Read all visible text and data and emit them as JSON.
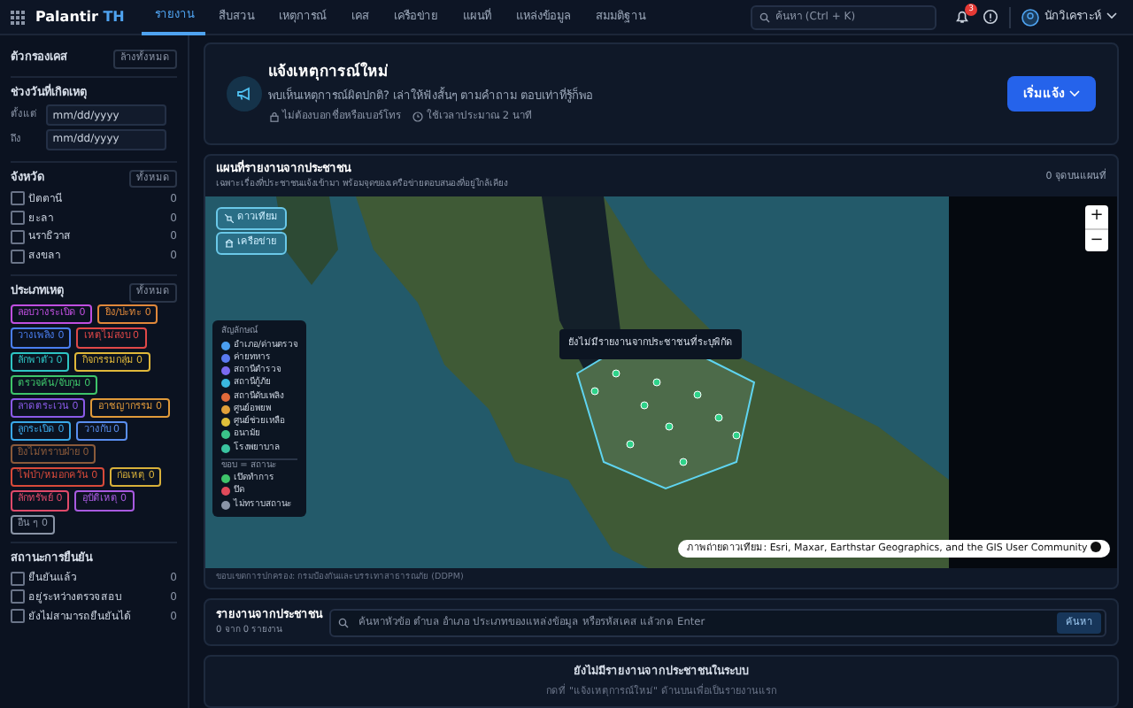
{
  "navbar": {
    "brand": "Palantir",
    "brand_suffix": "TH",
    "items": [
      {
        "label": "รายงาน",
        "selected": true
      },
      {
        "label": "สืบสวน",
        "selected": false
      },
      {
        "label": "เหตุการณ์",
        "selected": false
      },
      {
        "label": "เคส",
        "selected": false
      },
      {
        "label": "เครือข่าย",
        "selected": false
      },
      {
        "label": "แผนที่",
        "selected": false
      },
      {
        "label": "แหล่งข้อมูล",
        "selected": false
      },
      {
        "label": "สมมติฐาน",
        "selected": false
      }
    ],
    "search": {
      "placeholder": "ค้นหา (Ctrl + K)"
    },
    "notification_count": "3",
    "user": "นักวิเคราะห์"
  },
  "sidebar": {
    "title": "ตัวกรองเคส",
    "clear_button": "ล้างทั้งหมด",
    "date_range": {
      "title": "ช่วงวันที่เกิดเหตุ",
      "fields": [
        {
          "label": "ตั้งแต่",
          "placeholder": "mm/dd/yyyy"
        },
        {
          "label": "ถึง",
          "placeholder": "mm/dd/yyyy"
        }
      ]
    },
    "provinces": {
      "title": "จังหวัด",
      "all_button": "ทั้งหมด",
      "items": [
        {
          "label": "ปัตตานี",
          "count": "0",
          "checked": false
        },
        {
          "label": "ยะลา",
          "count": "0",
          "checked": false
        },
        {
          "label": "นราธิวาส",
          "count": "0",
          "checked": false
        },
        {
          "label": "สงขลา",
          "count": "0",
          "checked": false
        }
      ]
    },
    "incident_types": {
      "title": "ประเภทเหตุ",
      "all_button": "ทั้งหมด",
      "items": [
        {
          "label": "ลอบวางระเบิด 0",
          "color": "#c04fe0"
        },
        {
          "label": "ยิง/ปะทะ 0",
          "color": "#e0883a"
        },
        {
          "label": "วางเพลิง 0",
          "color": "#4a7ef0"
        },
        {
          "label": "เหตุไม่สงบ 0",
          "color": "#e04848"
        },
        {
          "label": "ลักพาตัว 0",
          "color": "#2ec4c4"
        },
        {
          "label": "กิจกรรมกลุ่ม 0",
          "color": "#e0b83a"
        },
        {
          "label": "ตรวจค้น/จับกุม 0",
          "color": "#3ec46a"
        },
        {
          "label": "ลาดตระเวน 0",
          "color": "#8a5ae8"
        },
        {
          "label": "อาชญากรรม 0",
          "color": "#e09a3a"
        },
        {
          "label": "ลูกระเบิด 0",
          "color": "#3aa8e8"
        },
        {
          "label": "วางกับ 0",
          "color": "#5a8ef0"
        },
        {
          "label": "ยิงไม่ทราบฝ่าย 0",
          "color": "#8a5a3a"
        },
        {
          "label": "ไฟป่า/หมอกควัน 0",
          "color": "#d84a3a"
        },
        {
          "label": "ก่อเหตุ 0",
          "color": "#d8b03a"
        },
        {
          "label": "ลักทรัพย์ 0",
          "color": "#e04a6a"
        },
        {
          "label": "อุบัติเหตุ 0",
          "color": "#a85ae0"
        },
        {
          "label": "อื่น ๆ 0",
          "color": "#8a94a6"
        }
      ]
    },
    "verification": {
      "title": "สถานะการยืนยัน",
      "items": [
        {
          "label": "ยืนยันแล้ว",
          "count": "0",
          "checked": false
        },
        {
          "label": "อยู่ระหว่างตรวจสอบ",
          "count": "0",
          "checked": false
        },
        {
          "label": "ยังไม่สามารถยืนยันได้",
          "count": "0",
          "checked": false
        }
      ]
    }
  },
  "report_banner": {
    "title": "แจ้งเหตุการณ์ใหม่",
    "text": "พบเห็นเหตุการณ์ผิดปกติ? เล่าให้ฟังสั้นๆ ตามคำถาม ตอบเท่าที่รู้ก็พอ",
    "notes": [
      {
        "kind": "lock",
        "text": "ไม่ต้องบอกชื่อหรือเบอร์โทร"
      },
      {
        "kind": "clock",
        "text": "ใช้เวลาประมาณ 2 นาที"
      }
    ],
    "button": "เริ่มแจ้ง"
  },
  "map_card": {
    "title": "แผนที่รายงานจากประชาชน",
    "subtitle": "เฉพาะเรื่องที่ประชาชนแจ้งเข้ามา พร้อมจุดของเครือข่ายตอบสนองที่อยู่ใกล้เคียง",
    "point_count": "0 จุดบนแผนที่",
    "layer_buttons": [
      {
        "kind": "satellite",
        "label": "ดาวเทียม"
      },
      {
        "kind": "network",
        "label": "เครือข่าย"
      }
    ],
    "zoom_buttons": [
      "+",
      "−"
    ],
    "legend": {
      "title": "สัญลักษณ์",
      "items": [
        {
          "label": "อำเภอ/ด่านตรวจ",
          "color": "#4a9ef0"
        },
        {
          "label": "ค่ายทหาร",
          "color": "#5a7af0"
        },
        {
          "label": "สถานีตำรวจ",
          "color": "#7a6af0"
        },
        {
          "label": "สถานีกู้ภัย",
          "color": "#3ab8e0"
        },
        {
          "label": "สถานีดับเพลิง",
          "color": "#e06a3a"
        },
        {
          "label": "ศูนย์อพยพ",
          "color": "#e0a03a"
        },
        {
          "label": "ศูนย์ช่วยเหลือ",
          "color": "#e0c03a"
        },
        {
          "label": "อนามัย",
          "color": "#3ac48a"
        },
        {
          "label": "โรงพยาบาล",
          "color": "#3ac4a0"
        }
      ],
      "status_title": "ขอบ = สถานะ",
      "status_items": [
        {
          "label": "เปิดทำการ",
          "color": "#3ec46a"
        },
        {
          "label": "ปิด",
          "color": "#e04a5a"
        },
        {
          "label": "ไม่ทราบสถานะ",
          "color": "#8a94a6"
        }
      ]
    },
    "tooltip": "ยังไม่มีรายงานจากประชาชนที่ระบุพิกัด",
    "attribution": "ภาพถ่ายดาวเทียม: Esri, Maxar, Earthstar Geographics, and the GIS User Community",
    "source": "ขอบเขตการปกครอง: กรมป้องกันและบรรเทาสาธารณภัย (DDPM)"
  },
  "reports": {
    "title": "รายงานจากประชาชน",
    "count": "0 จาก 0 รายงาน",
    "search": {
      "placeholder": "ค้นหาหัวข้อ ตำบล อำเภอ ประเภทของแหล่งข้อมูล หรือรหัสเคส แล้วกด Enter"
    },
    "button": "ค้นหา",
    "empty_title": "ยังไม่มีรายงานจากประชาชนในระบบ",
    "empty_text": "กดที่ \"แจ้งเหตุการณ์ใหม่\" ด้านบนเพื่อเป็นรายงานแรก"
  }
}
